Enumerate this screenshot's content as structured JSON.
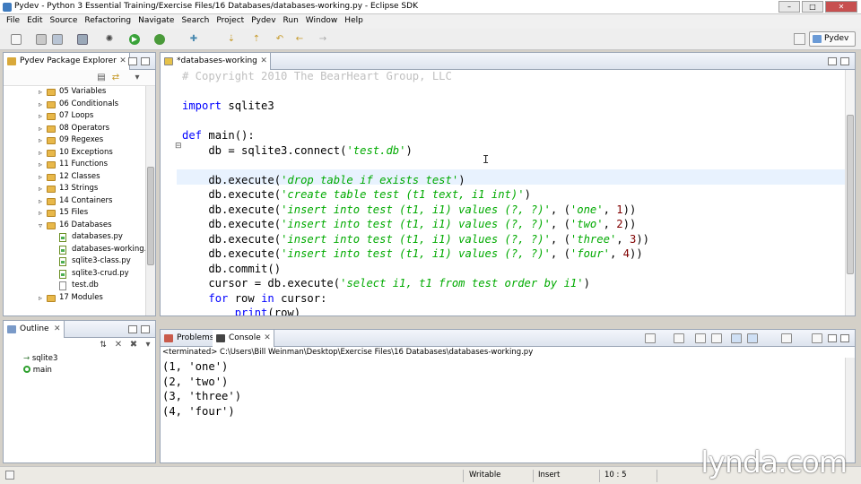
{
  "window": {
    "title": "Pydev - Python 3 Essential Training/Exercise Files/16 Databases/databases-working.py - Eclipse SDK"
  },
  "menu": [
    "File",
    "Edit",
    "Source",
    "Refactoring",
    "Navigate",
    "Search",
    "Project",
    "Pydev",
    "Run",
    "Window",
    "Help"
  ],
  "perspective": {
    "label": "Pydev"
  },
  "explorer": {
    "tab_label": "Pydev Package Explorer",
    "items": [
      {
        "label": "05 Variables",
        "kind": "folder"
      },
      {
        "label": "06 Conditionals",
        "kind": "folder"
      },
      {
        "label": "07 Loops",
        "kind": "folder"
      },
      {
        "label": "08 Operators",
        "kind": "folder"
      },
      {
        "label": "09 Regexes",
        "kind": "folder"
      },
      {
        "label": "10 Exceptions",
        "kind": "folder"
      },
      {
        "label": "11 Functions",
        "kind": "folder"
      },
      {
        "label": "12 Classes",
        "kind": "folder"
      },
      {
        "label": "13 Strings",
        "kind": "folder"
      },
      {
        "label": "14 Containers",
        "kind": "folder"
      },
      {
        "label": "15 Files",
        "kind": "folder"
      },
      {
        "label": "16 Databases",
        "kind": "folder-open"
      },
      {
        "label": "databases.py",
        "kind": "py"
      },
      {
        "label": "databases-working.p",
        "kind": "py"
      },
      {
        "label": "sqlite3-class.py",
        "kind": "py"
      },
      {
        "label": "sqlite3-crud.py",
        "kind": "py"
      },
      {
        "label": "test.db",
        "kind": "db"
      },
      {
        "label": "17 Modules",
        "kind": "folder"
      }
    ]
  },
  "outline": {
    "tab_label": "Outline",
    "items": [
      {
        "label": "sqlite3",
        "kind": "import"
      },
      {
        "label": "main",
        "kind": "function"
      }
    ]
  },
  "editor": {
    "tab_label": "*databases-working",
    "lines": [
      {
        "parts": [
          {
            "t": "# Copyright 2010 The BearHeart Group, LLC",
            "c": "cmt"
          }
        ]
      },
      {
        "parts": []
      },
      {
        "parts": [
          {
            "t": "import",
            "c": "kw"
          },
          {
            "t": " sqlite3",
            "c": ""
          }
        ]
      },
      {
        "parts": []
      },
      {
        "parts": [
          {
            "t": "def",
            "c": "kw"
          },
          {
            "t": " ",
            "c": ""
          },
          {
            "t": "main",
            "c": "fn"
          },
          {
            "t": "():",
            "c": ""
          }
        ]
      },
      {
        "parts": [
          {
            "t": "    db = sqlite3.connect(",
            "c": ""
          },
          {
            "t": "'test.db'",
            "c": "str"
          },
          {
            "t": ")",
            "c": ""
          }
        ]
      },
      {
        "parts": []
      },
      {
        "parts": [
          {
            "t": "    db.execute(",
            "c": ""
          },
          {
            "t": "'drop table if exists test'",
            "c": "str"
          },
          {
            "t": ")",
            "c": ""
          }
        ]
      },
      {
        "parts": [
          {
            "t": "    db.execute(",
            "c": ""
          },
          {
            "t": "'create table test (t1 text, i1 int)'",
            "c": "str"
          },
          {
            "t": ")",
            "c": ""
          }
        ]
      },
      {
        "parts": [
          {
            "t": "    db.execute(",
            "c": ""
          },
          {
            "t": "'insert into test (t1, i1) values (?, ?)'",
            "c": "str"
          },
          {
            "t": ", (",
            "c": ""
          },
          {
            "t": "'one'",
            "c": "str"
          },
          {
            "t": ", ",
            "c": ""
          },
          {
            "t": "1",
            "c": "num"
          },
          {
            "t": "))",
            "c": ""
          }
        ]
      },
      {
        "parts": [
          {
            "t": "    db.execute(",
            "c": ""
          },
          {
            "t": "'insert into test (t1, i1) values (?, ?)'",
            "c": "str"
          },
          {
            "t": ", (",
            "c": ""
          },
          {
            "t": "'two'",
            "c": "str"
          },
          {
            "t": ", ",
            "c": ""
          },
          {
            "t": "2",
            "c": "num"
          },
          {
            "t": "))",
            "c": ""
          }
        ]
      },
      {
        "parts": [
          {
            "t": "    db.execute(",
            "c": ""
          },
          {
            "t": "'insert into test (t1, i1) values (?, ?)'",
            "c": "str"
          },
          {
            "t": ", (",
            "c": ""
          },
          {
            "t": "'three'",
            "c": "str"
          },
          {
            "t": ", ",
            "c": ""
          },
          {
            "t": "3",
            "c": "num"
          },
          {
            "t": "))",
            "c": ""
          }
        ]
      },
      {
        "parts": [
          {
            "t": "    db.execute(",
            "c": ""
          },
          {
            "t": "'insert into test (t1, i1) values (?, ?)'",
            "c": "str"
          },
          {
            "t": ", (",
            "c": ""
          },
          {
            "t": "'four'",
            "c": "str"
          },
          {
            "t": ", ",
            "c": ""
          },
          {
            "t": "4",
            "c": "num"
          },
          {
            "t": "))",
            "c": ""
          }
        ]
      },
      {
        "parts": [
          {
            "t": "    db.commit()",
            "c": ""
          }
        ]
      },
      {
        "parts": [
          {
            "t": "    cursor = db.execute(",
            "c": ""
          },
          {
            "t": "'select i1, t1 from test order by i1'",
            "c": "str"
          },
          {
            "t": ")",
            "c": ""
          }
        ]
      },
      {
        "parts": [
          {
            "t": "    ",
            "c": ""
          },
          {
            "t": "for",
            "c": "kw"
          },
          {
            "t": " row ",
            "c": ""
          },
          {
            "t": "in",
            "c": "kw"
          },
          {
            "t": " cursor:",
            "c": ""
          }
        ]
      },
      {
        "parts": [
          {
            "t": "        ",
            "c": ""
          },
          {
            "t": "print",
            "c": "kw"
          },
          {
            "t": "(row)",
            "c": ""
          }
        ]
      }
    ]
  },
  "console": {
    "tabs": [
      "Problems",
      "Console"
    ],
    "terminated": "<terminated> C:\\Users\\Bill Weinman\\Desktop\\Exercise Files\\16 Databases\\databases-working.py",
    "output": [
      "(1, 'one')",
      "(2, 'two')",
      "(3, 'three')",
      "(4, 'four')"
    ]
  },
  "status": {
    "writable": "Writable",
    "insert": "Insert",
    "position": "10 : 5"
  },
  "watermark": "lynda.com",
  "colors": {
    "keyword": "#0000ff",
    "string": "#00aa00",
    "number": "#800000",
    "comment": "#c0c0c0",
    "current_line": "#e8f2fe"
  }
}
